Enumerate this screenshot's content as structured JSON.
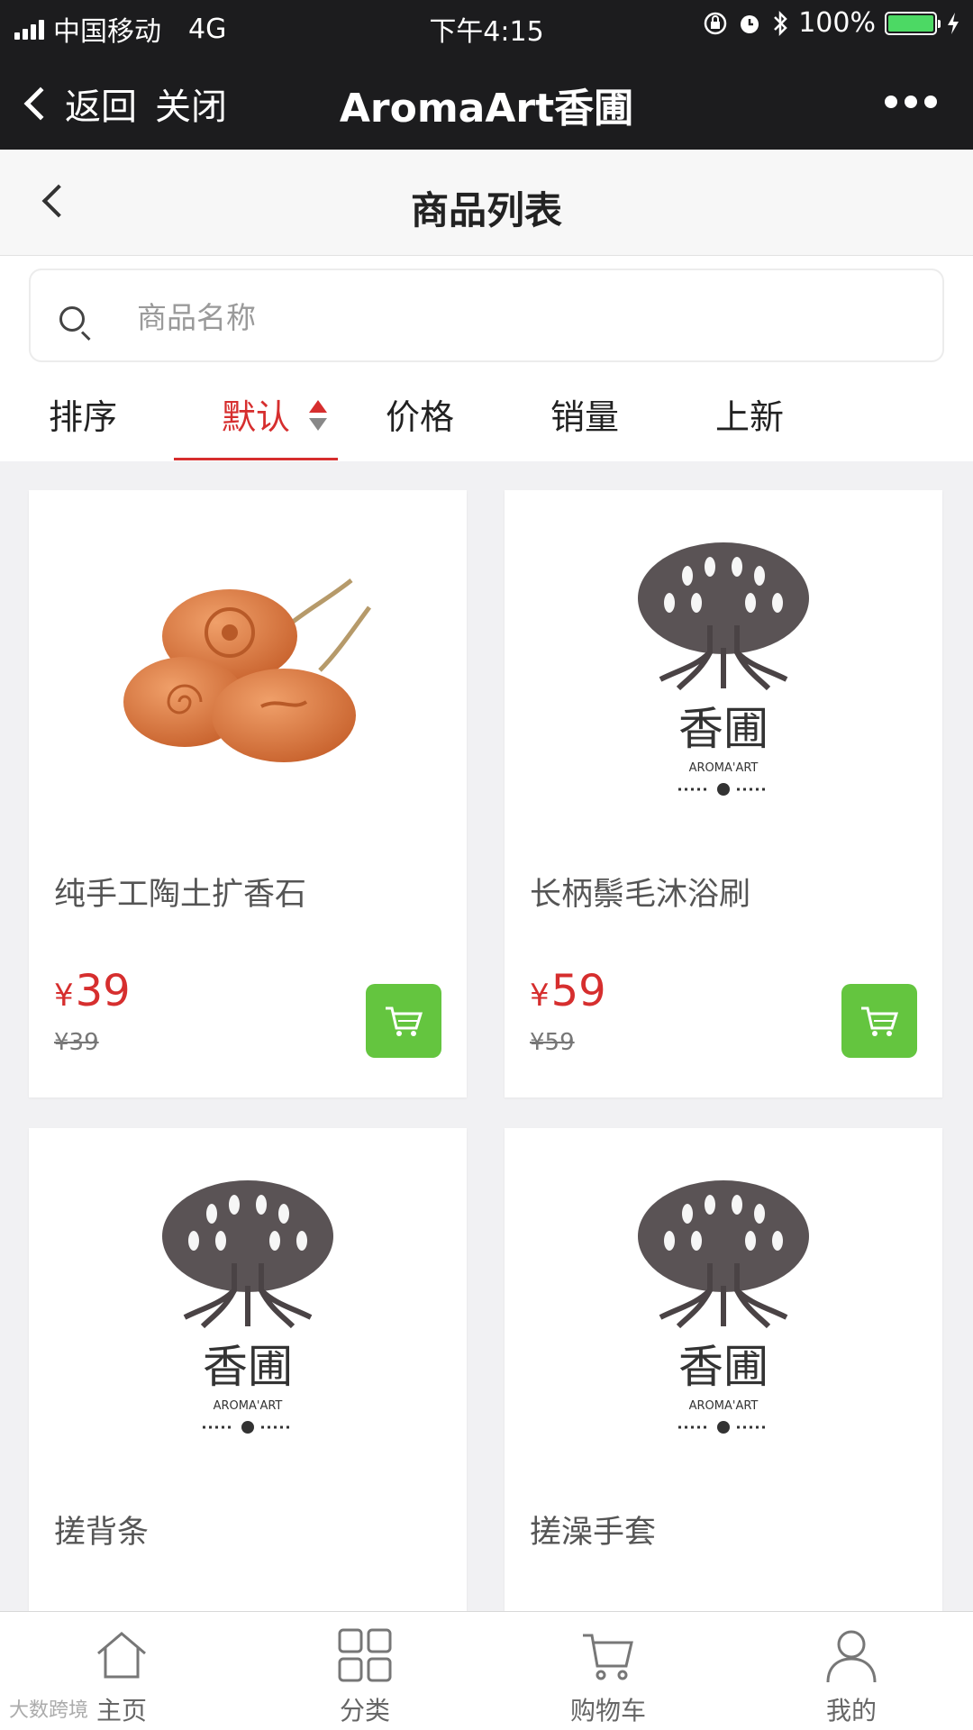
{
  "status_bar": {
    "carrier": "中国移动",
    "network": "4G",
    "time": "下午4:15",
    "battery": "100%"
  },
  "wechat_bar": {
    "back_label": "返回",
    "close_label": "关闭",
    "title": "AromaArt香圃"
  },
  "page": {
    "title": "商品列表"
  },
  "search": {
    "placeholder": "商品名称",
    "value": ""
  },
  "sort": {
    "label": "排序",
    "options": [
      "默认",
      "价格",
      "销量",
      "上新"
    ],
    "active": "默认"
  },
  "products": [
    {
      "name": "纯手工陶土扩香石",
      "price": "39",
      "original_price": "¥39",
      "image": "clay-diffuser-stones"
    },
    {
      "name": "长柄鬃毛沐浴刷",
      "price": "59",
      "original_price": "¥59",
      "image": "aroma-art-logo"
    },
    {
      "name": "搓背条",
      "image": "aroma-art-logo"
    },
    {
      "name": "搓澡手套",
      "image": "aroma-art-logo"
    }
  ],
  "logo": {
    "brand_cn": "香圃",
    "brand_en": "AROMA'ART"
  },
  "currency_symbol": "¥",
  "tabbar": {
    "items": [
      {
        "label": "主页",
        "icon": "home-icon"
      },
      {
        "label": "分类",
        "icon": "grid-icon"
      },
      {
        "label": "购物车",
        "icon": "cart-icon"
      },
      {
        "label": "我的",
        "icon": "user-icon"
      }
    ]
  },
  "watermark": "大数跨境",
  "colors": {
    "accent_red": "#d62e2e",
    "cart_green": "#64c53f",
    "topbar": "#1c1c1e",
    "battery_green": "#4cd964"
  }
}
